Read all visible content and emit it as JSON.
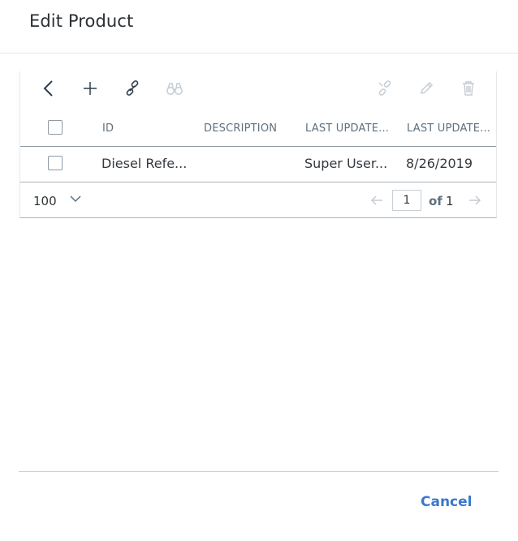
{
  "dialog": {
    "title": "Edit Product"
  },
  "toolbar": {
    "back_icon": "chevron-left-icon",
    "add_icon": "plus-icon",
    "link_icon": "link-icon",
    "find_icon": "binoculars-icon",
    "unlink_icon": "unlink-icon",
    "edit_icon": "pencil-icon",
    "delete_icon": "trash-icon"
  },
  "table": {
    "columns": [
      "ID",
      "DESCRIPTION",
      "LAST UPDATE...",
      "LAST UPDATE..."
    ],
    "rows": [
      {
        "id": "Diesel Refe...",
        "description": "",
        "last_updated_by": "Super User...",
        "last_updated": "8/26/2019"
      }
    ]
  },
  "pager": {
    "page_size": "100",
    "current_page": "1",
    "of_label": "of",
    "total_pages": "1"
  },
  "footer": {
    "cancel_label": "Cancel"
  },
  "colors": {
    "accent": "#3b78c9",
    "icon_active": "#2f3e4d",
    "icon_disabled": "#c5ccd2"
  }
}
